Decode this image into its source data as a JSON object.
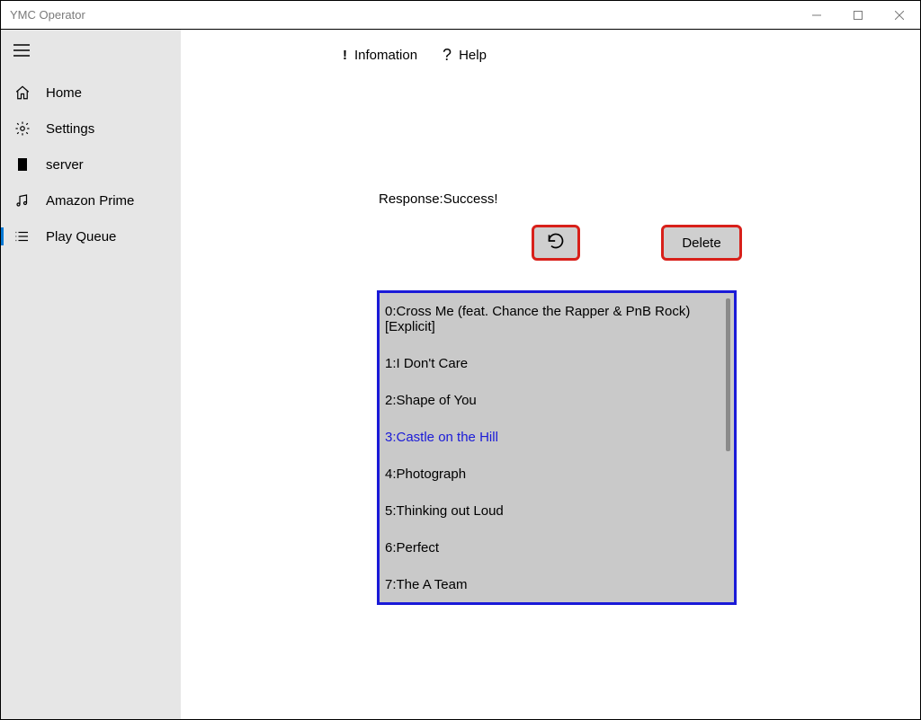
{
  "window": {
    "title": "YMC Operator"
  },
  "sidebar": {
    "items": [
      {
        "label": "Home"
      },
      {
        "label": "Settings"
      },
      {
        "label": "server"
      },
      {
        "label": "Amazon Prime"
      },
      {
        "label": "Play Queue"
      }
    ]
  },
  "topbar": {
    "info_label": "Infomation",
    "help_label": "Help"
  },
  "main": {
    "response_text": "Response:Success!",
    "delete_label": "Delete"
  },
  "queue": {
    "items": [
      {
        "text": "0:Cross Me (feat. Chance the Rapper & PnB Rock) [Explicit]"
      },
      {
        "text": "1:I Don't Care"
      },
      {
        "text": "2:Shape of You"
      },
      {
        "text": "3:Castle on the Hill"
      },
      {
        "text": "4:Photograph"
      },
      {
        "text": "5:Thinking out Loud"
      },
      {
        "text": "6:Perfect"
      },
      {
        "text": "7:The A Team"
      }
    ],
    "selected_index": 3
  }
}
